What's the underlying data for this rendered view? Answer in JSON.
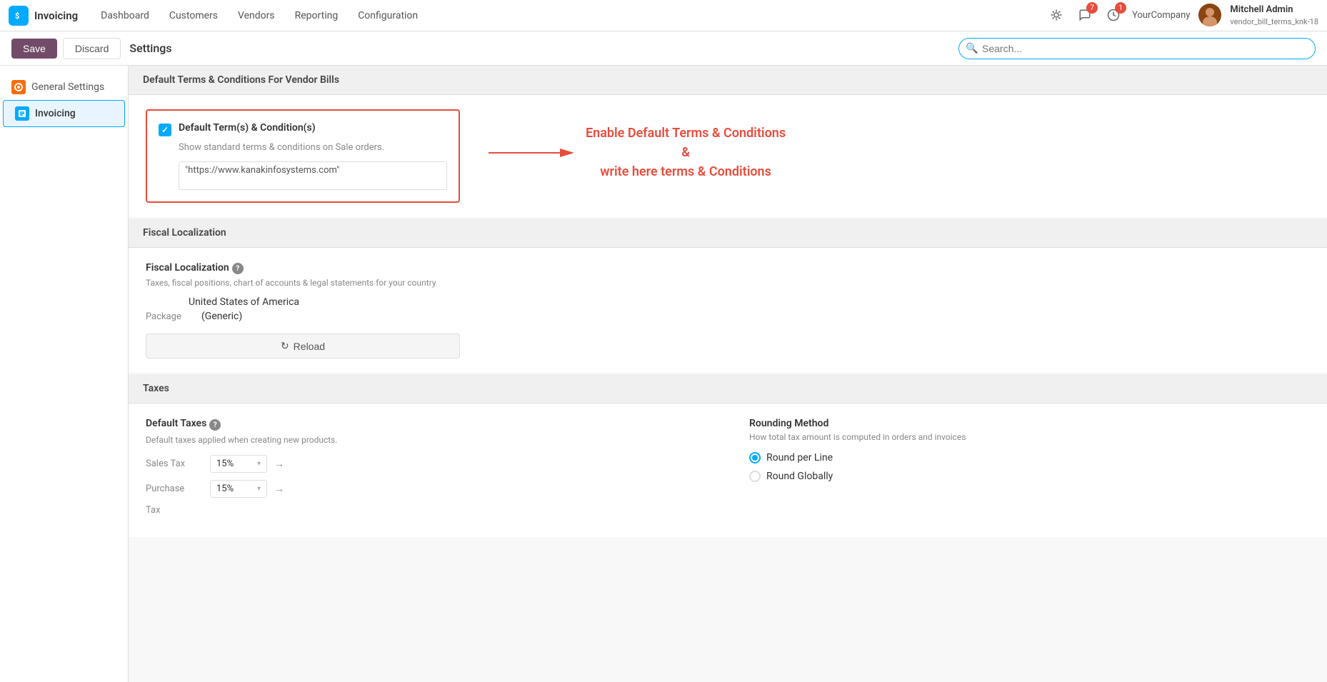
{
  "app": {
    "logo": "S",
    "name": "Invoicing"
  },
  "nav": {
    "links": [
      {
        "label": "Dashboard",
        "active": false
      },
      {
        "label": "Customers",
        "active": false
      },
      {
        "label": "Vendors",
        "active": false
      },
      {
        "label": "Reporting",
        "active": false
      },
      {
        "label": "Configuration",
        "active": false
      }
    ]
  },
  "nav_right": {
    "bug_icon": "🐛",
    "chat_badge": "7",
    "activity_badge": "1",
    "company": "YourCompany",
    "user_name": "Mitchell Admin",
    "user_branch": "vendor_bill_terms_knk-18"
  },
  "toolbar": {
    "save_label": "Save",
    "discard_label": "Discard",
    "title": "Settings",
    "search_placeholder": "Search..."
  },
  "sidebar": {
    "items": [
      {
        "label": "General Settings",
        "icon_type": "orange"
      },
      {
        "label": "Invoicing",
        "icon_type": "blue",
        "active": true
      }
    ]
  },
  "sections": {
    "terms": {
      "header": "Default Terms & Conditions For Vendor Bills",
      "checkbox_checked": true,
      "label": "Default Term(s) & Condition(s)",
      "description": "Show standard terms & conditions on Sale orders.",
      "url_value": "\"https://www.kanakinfosystems.com\"",
      "annotation": "Enable Default Terms & Conditions\n&\nwrite here terms & Conditions"
    },
    "fiscal": {
      "header": "Fiscal Localization",
      "field_label": "Fiscal Localization",
      "field_desc": "Taxes, fiscal positions, chart of accounts & legal statements for your country",
      "country": "United States of America",
      "package_label": "Package",
      "package_value": "(Generic)",
      "reload_label": "Reload"
    },
    "taxes": {
      "header": "Taxes",
      "default_taxes_label": "Default Taxes",
      "default_taxes_desc": "Default taxes applied when creating new products.",
      "sales_tax_label": "Sales Tax",
      "sales_tax_value": "15%",
      "purchase_label": "Purchase",
      "purchase_value": "15%",
      "tax_label": "Tax",
      "rounding_label": "Rounding Method",
      "rounding_desc": "How total tax amount is computed in orders and invoices",
      "round_per_line": "Round per Line",
      "round_globally": "Round Globally"
    }
  },
  "icons": {
    "search": "🔍",
    "reload": "↻",
    "chevron_down": "▾",
    "arrow_right": "→",
    "help": "?"
  }
}
